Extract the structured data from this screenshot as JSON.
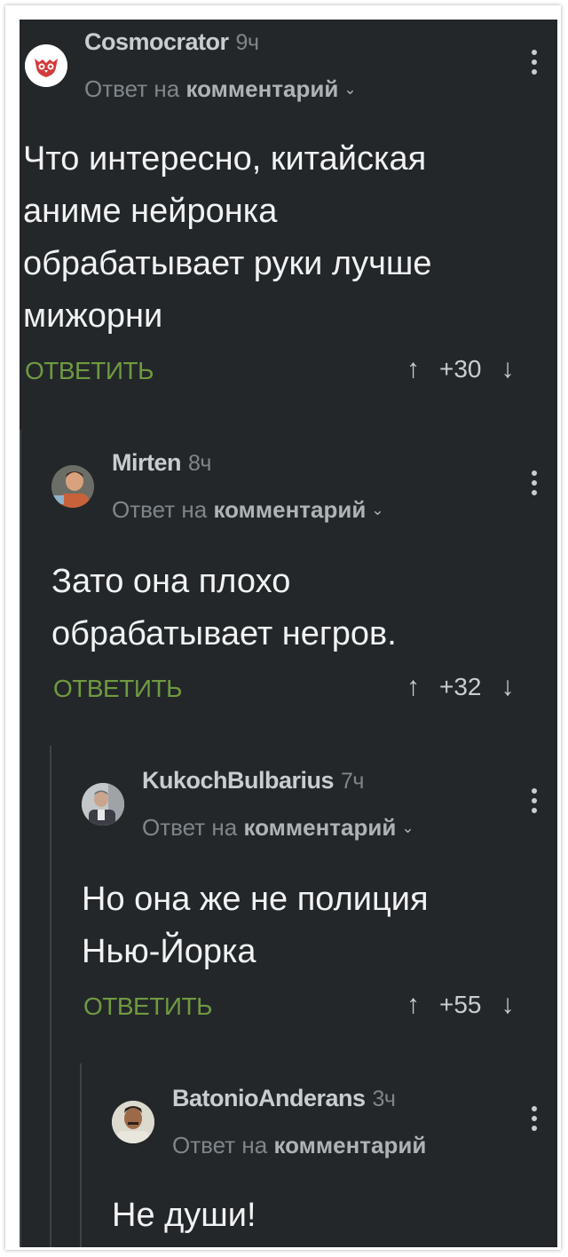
{
  "comments": [
    {
      "author": "Cosmocrator",
      "time": "9ч",
      "reply_prefix": "Ответ на",
      "reply_target": "комментарий",
      "text_lines": [
        "Что интересно, китайская",
        "аниме нейронка",
        "обрабатывает руки лучше",
        "мижорни"
      ],
      "reply_label": "ОТВЕТИТЬ",
      "score": "+30",
      "avatar_icon": "owl-logo-icon"
    },
    {
      "author": "Mirten",
      "time": "8ч",
      "reply_prefix": "Ответ на",
      "reply_target": "комментарий",
      "text_lines": [
        "Зато она плохо",
        "обрабатывает негров."
      ],
      "reply_label": "ОТВЕТИТЬ",
      "score": "+32",
      "avatar_icon": "user-photo-icon"
    },
    {
      "author": "KukochBulbarius",
      "time": "7ч",
      "reply_prefix": "Ответ на",
      "reply_target": "комментарий",
      "text_lines": [
        "Но она же не полиция",
        "Нью-Йорка"
      ],
      "reply_label": "ОТВЕТИТЬ",
      "score": "+55",
      "avatar_icon": "user-photo-icon"
    },
    {
      "author": "BatonioAnderans",
      "time": "3ч",
      "reply_prefix": "Ответ на",
      "reply_target": "комментарий",
      "text_lines": [
        "Не души!"
      ],
      "avatar_icon": "user-photo-icon"
    }
  ],
  "icons": {
    "upvote": "↑",
    "downvote": "↓",
    "chevron": "⌄"
  },
  "colors": {
    "background": "#23272a",
    "accent_green": "#6f9a3f",
    "text": "#f0f2f3",
    "muted": "#7f868b"
  }
}
